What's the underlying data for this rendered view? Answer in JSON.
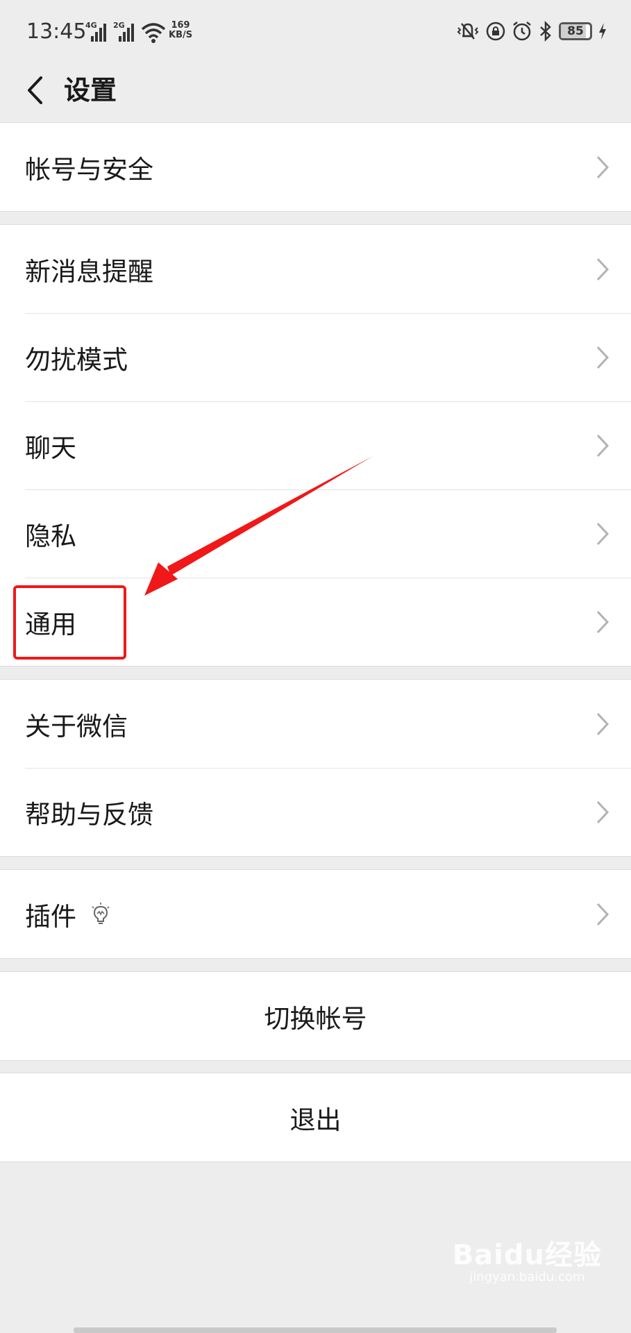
{
  "status_bar": {
    "time": "13:45",
    "sim1_tag": "4G",
    "sim2_tag": "2G",
    "speed_value": "169",
    "speed_unit": "KB/S",
    "battery": "85",
    "battery_level": 0.85
  },
  "header": {
    "back_icon": "chevron-left-icon",
    "title": "设置"
  },
  "groups": [
    {
      "items": [
        {
          "label": "帐号与安全"
        }
      ]
    },
    {
      "items": [
        {
          "label": "新消息提醒"
        },
        {
          "label": "勿扰模式"
        },
        {
          "label": "聊天"
        },
        {
          "label": "隐私"
        },
        {
          "label": "通用"
        }
      ]
    },
    {
      "items": [
        {
          "label": "关于微信"
        },
        {
          "label": "帮助与反馈"
        }
      ]
    },
    {
      "items": [
        {
          "label": "插件",
          "icon": "lightbulb-icon"
        }
      ]
    }
  ],
  "actions": {
    "switch_account": "切换帐号",
    "logout": "退出"
  },
  "watermark": {
    "logo": "Baidu经验",
    "url": "jingyan.baidu.com"
  },
  "colors": {
    "background": "#ededed",
    "annotation_red": "#f01818",
    "chevron": "#b2b2b2"
  }
}
